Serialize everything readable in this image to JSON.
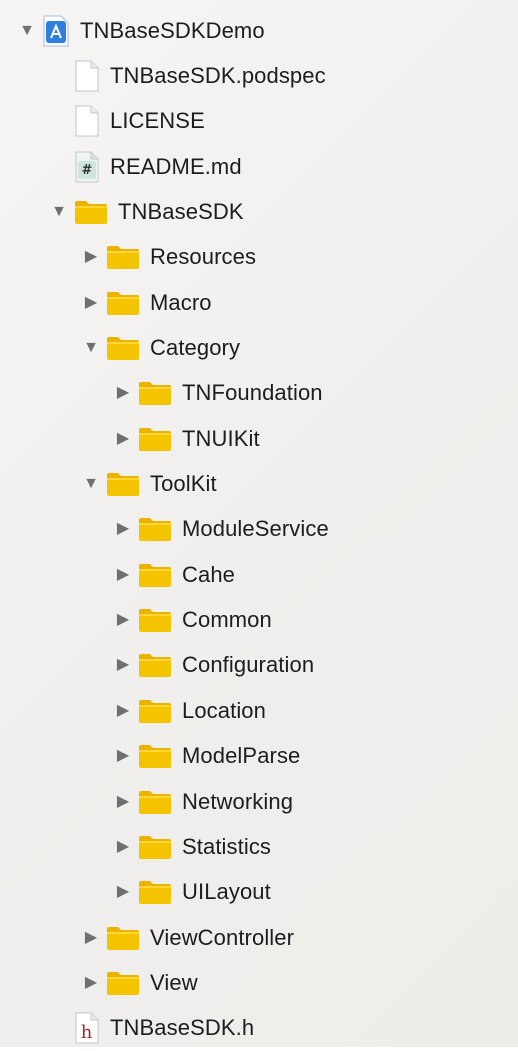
{
  "navigator": {
    "items": [
      {
        "label": "TNBaseSDKDemo",
        "icon": "xcode-project-icon",
        "disclosure": "expanded",
        "depth": 0
      },
      {
        "label": "TNBaseSDK.podspec",
        "icon": "document-icon",
        "disclosure": "none",
        "depth": 1
      },
      {
        "label": "LICENSE",
        "icon": "document-icon",
        "disclosure": "none",
        "depth": 1
      },
      {
        "label": "README.md",
        "icon": "markdown-file-icon",
        "disclosure": "none",
        "depth": 1
      },
      {
        "label": "TNBaseSDK",
        "icon": "folder-icon",
        "disclosure": "expanded",
        "depth": 1
      },
      {
        "label": "Resources",
        "icon": "folder-icon",
        "disclosure": "collapsed",
        "depth": 2
      },
      {
        "label": "Macro",
        "icon": "folder-icon",
        "disclosure": "collapsed",
        "depth": 2
      },
      {
        "label": "Category",
        "icon": "folder-icon",
        "disclosure": "expanded",
        "depth": 2
      },
      {
        "label": "TNFoundation",
        "icon": "folder-icon",
        "disclosure": "collapsed",
        "depth": 3
      },
      {
        "label": "TNUIKit",
        "icon": "folder-icon",
        "disclosure": "collapsed",
        "depth": 3
      },
      {
        "label": "ToolKit",
        "icon": "folder-icon",
        "disclosure": "expanded",
        "depth": 2
      },
      {
        "label": "ModuleService",
        "icon": "folder-icon",
        "disclosure": "collapsed",
        "depth": 3
      },
      {
        "label": "Cahe",
        "icon": "folder-icon",
        "disclosure": "collapsed",
        "depth": 3
      },
      {
        "label": "Common",
        "icon": "folder-icon",
        "disclosure": "collapsed",
        "depth": 3
      },
      {
        "label": "Configuration",
        "icon": "folder-icon",
        "disclosure": "collapsed",
        "depth": 3
      },
      {
        "label": "Location",
        "icon": "folder-icon",
        "disclosure": "collapsed",
        "depth": 3
      },
      {
        "label": "ModelParse",
        "icon": "folder-icon",
        "disclosure": "collapsed",
        "depth": 3
      },
      {
        "label": "Networking",
        "icon": "folder-icon",
        "disclosure": "collapsed",
        "depth": 3
      },
      {
        "label": "Statistics",
        "icon": "folder-icon",
        "disclosure": "collapsed",
        "depth": 3
      },
      {
        "label": "UILayout",
        "icon": "folder-icon",
        "disclosure": "collapsed",
        "depth": 3
      },
      {
        "label": "ViewController",
        "icon": "folder-icon",
        "disclosure": "collapsed",
        "depth": 2
      },
      {
        "label": "View",
        "icon": "folder-icon",
        "disclosure": "collapsed",
        "depth": 2
      },
      {
        "label": "TNBaseSDK.h",
        "icon": "header-file-icon",
        "disclosure": "none",
        "depth": 1
      }
    ],
    "colors": {
      "folder": "#f5c400",
      "folder_tab": "#e8b400",
      "text": "#1d1d1d",
      "disclosure": "#6f6f6f",
      "header_h": "#a3262a",
      "project_blue": "#2f7fe0"
    }
  }
}
